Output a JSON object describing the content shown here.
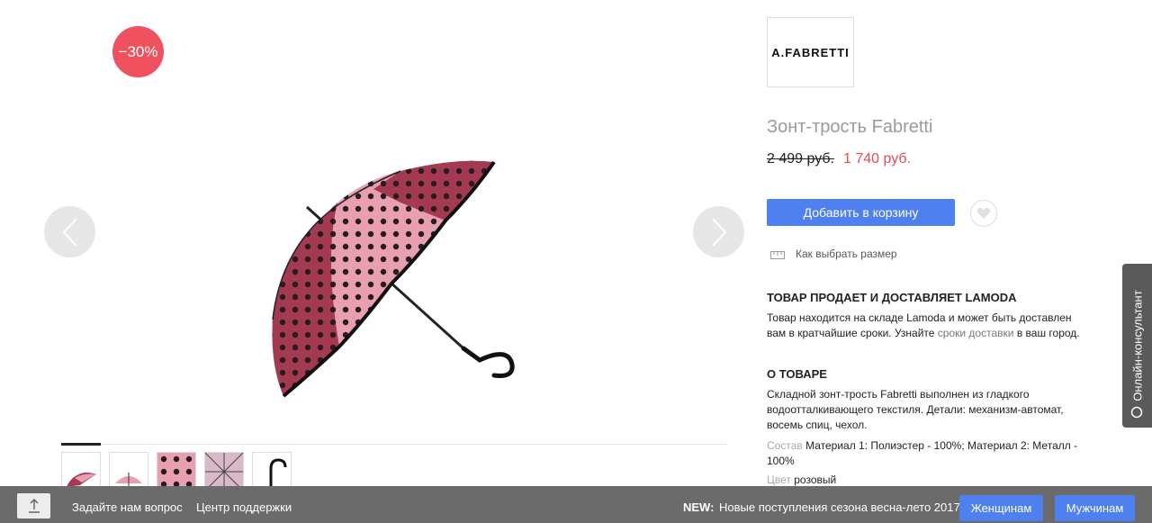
{
  "gallery": {
    "discount_badge": "−30%"
  },
  "product": {
    "brand": "A.FABRETTI",
    "title": "Зонт-трость Fabretti",
    "old_price": "2 499 руб.",
    "new_price": "1 740 руб.",
    "add_to_cart": "Добавить в корзину",
    "size_guide": "Как выбрать размер"
  },
  "delivery": {
    "heading": "ТОВАР ПРОДАЕТ И ДОСТАВЛЯЕТ LAMODA",
    "text_before": "Товар находится на складе Lamoda и может быть доставлен вам в кратчайшие сроки. Узнайте ",
    "link": "сроки доставки",
    "text_after": " в ваш город."
  },
  "about": {
    "heading": "О ТОВАРЕ",
    "description": "Складной зонт-трость Fabretti выполнен из гладкого водоотталкивающего текстиля. Детали: механизм-автомат, восемь спиц, чехол.",
    "composition_label": "Состав",
    "composition_value": "Материал 1: Полиэстер - 100%; Материал 2: Металл - 100%",
    "color_label": "Цвет",
    "color_value": "розовый"
  },
  "consultant": {
    "label": "Онлайн-консультант"
  },
  "bottom_bar": {
    "ask_question": "Задайте нам вопрос",
    "support": "Центр поддержки",
    "new_label": "NEW:",
    "new_text": "Новые поступления сезона весна-лето 2017!",
    "women_button": "Женщинам",
    "men_button": "Мужчинам"
  },
  "colors": {
    "accent_blue": "#4e80f0",
    "sale_red": "#e64c55",
    "badge_red": "#f0515e",
    "umbrella_pink": "#e8a0b0",
    "umbrella_dark": "#a33a52"
  }
}
